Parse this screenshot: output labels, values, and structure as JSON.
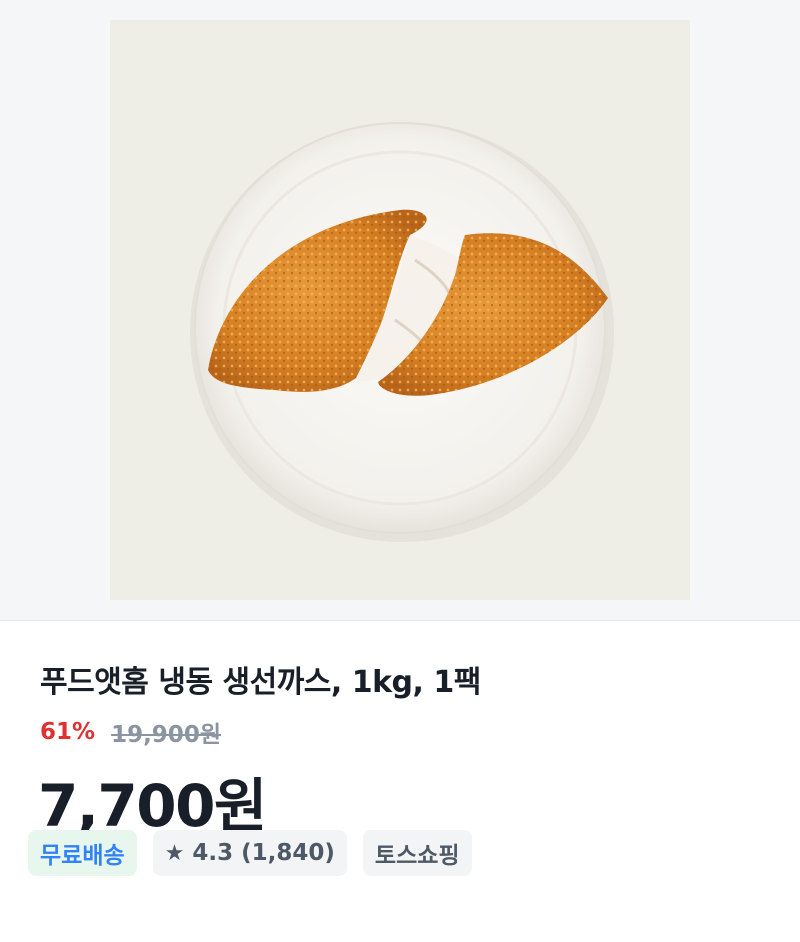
{
  "product": {
    "image_alt": "생선까스",
    "title": "푸드앳홈 냉동 생선까스, 1kg, 1팩",
    "discount": "61%",
    "original_price": "19,900원",
    "price": "7,700원"
  },
  "badges": {
    "shipping": "무료배송",
    "rating_icon": "star-icon",
    "rating": "4.3",
    "rating_count": "(1,840)",
    "store": "토스쇼핑"
  },
  "colors": {
    "discount": "#e03131",
    "free_shipping_text": "#3182f6",
    "free_shipping_bg": "#e8f7ee"
  }
}
